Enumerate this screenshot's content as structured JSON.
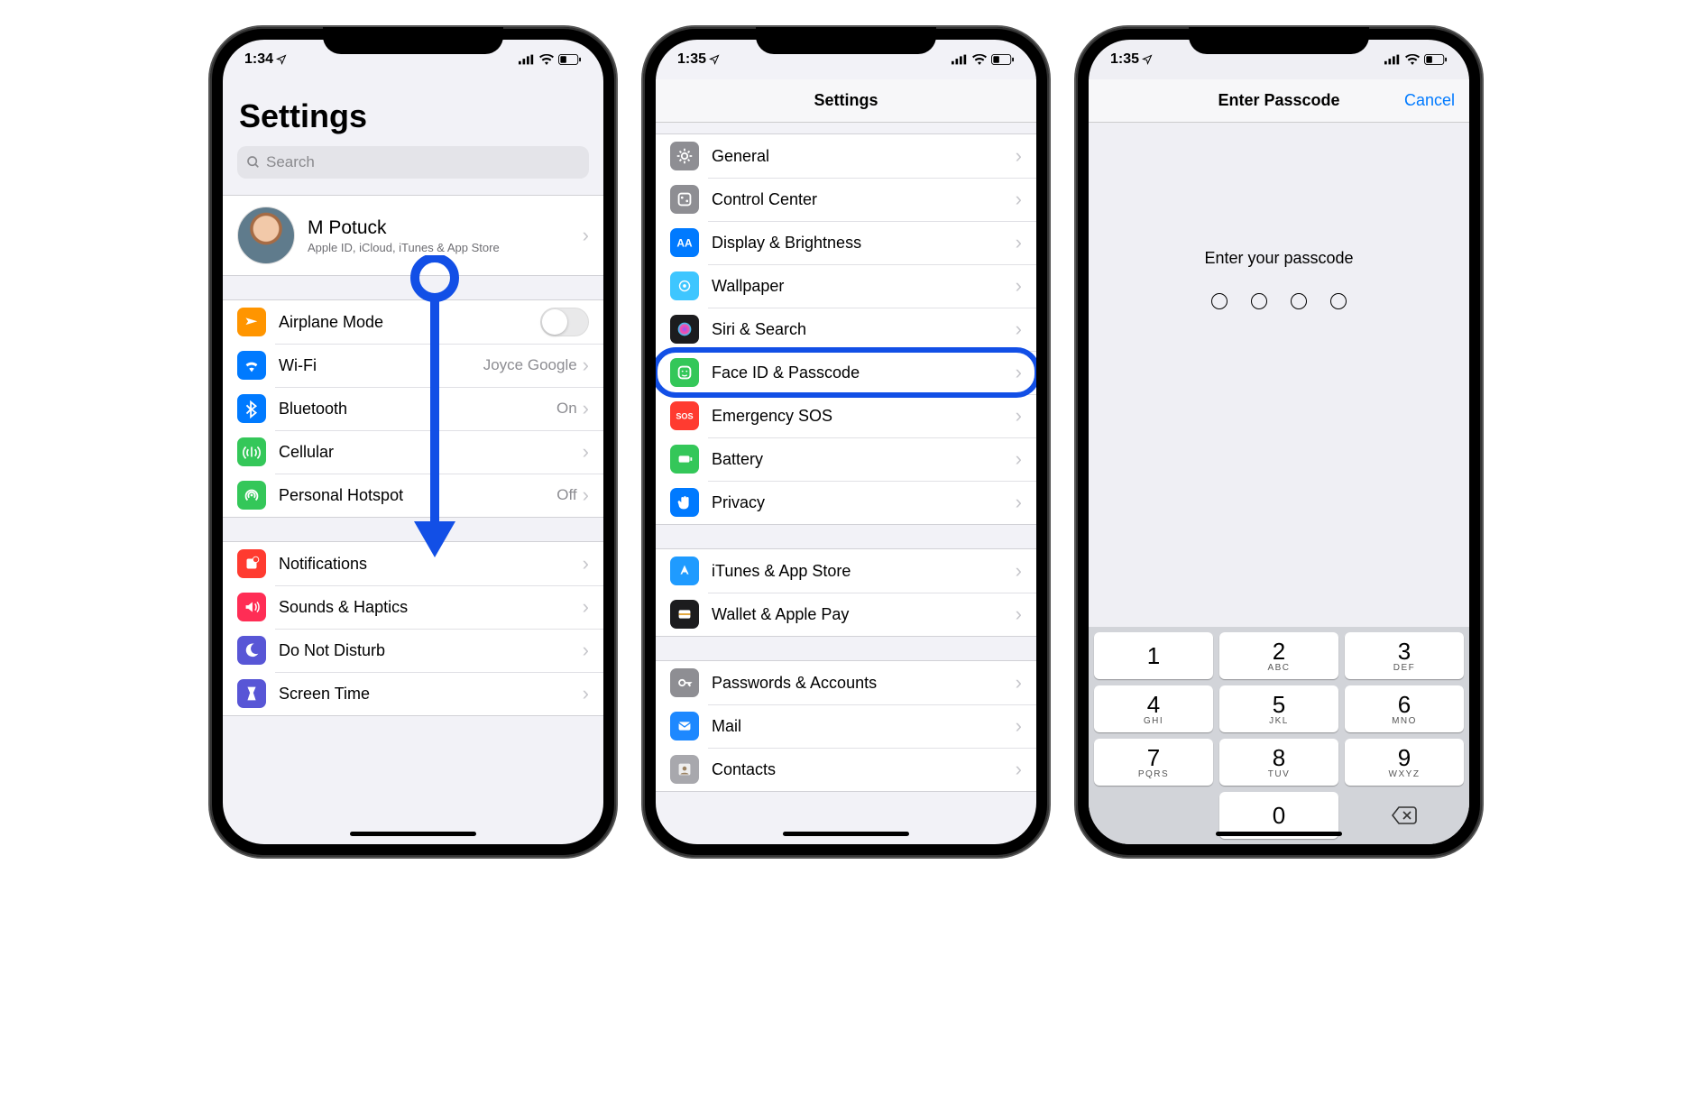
{
  "status": {
    "time1": "1:34",
    "time2": "1:35",
    "time3": "1:35"
  },
  "screen1": {
    "title": "Settings",
    "search_placeholder": "Search",
    "profile": {
      "name": "M Potuck",
      "sub": "Apple ID, iCloud, iTunes & App Store"
    },
    "rows_a": [
      {
        "icon": "airplane",
        "bg": "#ff9500",
        "label": "Airplane Mode",
        "control": "toggle"
      },
      {
        "icon": "wifi",
        "bg": "#007aff",
        "label": "Wi-Fi",
        "value": "Joyce Google"
      },
      {
        "icon": "bluetooth",
        "bg": "#007aff",
        "label": "Bluetooth",
        "value": "On"
      },
      {
        "icon": "cellular",
        "bg": "#34c759",
        "label": "Cellular"
      },
      {
        "icon": "hotspot",
        "bg": "#34c759",
        "label": "Personal Hotspot",
        "value": "Off"
      }
    ],
    "rows_b": [
      {
        "icon": "notif",
        "bg": "#ff3b30",
        "label": "Notifications"
      },
      {
        "icon": "sound",
        "bg": "#ff2d55",
        "label": "Sounds & Haptics"
      },
      {
        "icon": "dnd",
        "bg": "#5856d6",
        "label": "Do Not Disturb"
      },
      {
        "icon": "timer",
        "bg": "#5856d6",
        "label": "Screen Time"
      }
    ]
  },
  "screen2": {
    "title": "Settings",
    "rows_a": [
      {
        "icon": "gear",
        "bg": "#8e8e93",
        "label": "General"
      },
      {
        "icon": "cc",
        "bg": "#8e8e93",
        "label": "Control Center"
      },
      {
        "icon": "aa",
        "bg": "#007aff",
        "label": "Display & Brightness"
      },
      {
        "icon": "wall",
        "bg": "#3ec6ff",
        "label": "Wallpaper"
      },
      {
        "icon": "siri",
        "bg": "#1c1c1e",
        "label": "Siri & Search"
      },
      {
        "icon": "face",
        "bg": "#34c759",
        "label": "Face ID & Passcode",
        "highlight": true
      },
      {
        "icon": "sos",
        "bg": "#ff3b30",
        "label": "Emergency SOS"
      },
      {
        "icon": "batt",
        "bg": "#34c759",
        "label": "Battery"
      },
      {
        "icon": "hand",
        "bg": "#007aff",
        "label": "Privacy"
      }
    ],
    "rows_b": [
      {
        "icon": "store",
        "bg": "#1f9bff",
        "label": "iTunes & App Store"
      },
      {
        "icon": "wallet",
        "bg": "#1c1c1e",
        "label": "Wallet & Apple Pay"
      }
    ],
    "rows_c": [
      {
        "icon": "key",
        "bg": "#8e8e93",
        "label": "Passwords & Accounts"
      },
      {
        "icon": "mail",
        "bg": "#1d88ff",
        "label": "Mail"
      },
      {
        "icon": "cont",
        "bg": "#a8a8ad",
        "label": "Contacts"
      }
    ]
  },
  "screen3": {
    "title": "Enter Passcode",
    "cancel": "Cancel",
    "prompt": "Enter your passcode",
    "keypad": [
      {
        "n": "1",
        "l": ""
      },
      {
        "n": "2",
        "l": "ABC"
      },
      {
        "n": "3",
        "l": "DEF"
      },
      {
        "n": "4",
        "l": "GHI"
      },
      {
        "n": "5",
        "l": "JKL"
      },
      {
        "n": "6",
        "l": "MNO"
      },
      {
        "n": "7",
        "l": "PQRS"
      },
      {
        "n": "8",
        "l": "TUV"
      },
      {
        "n": "9",
        "l": "WXYZ"
      },
      {
        "blank": true
      },
      {
        "n": "0",
        "l": ""
      },
      {
        "backspace": true
      }
    ]
  },
  "icons": {
    "airplane": "✈",
    "wifi": "wifi",
    "bluetooth": "bt",
    "cellular": "ant",
    "hotspot": "link",
    "notif": "□",
    "sound": "🔊",
    "dnd": "☾",
    "timer": "⌛",
    "gear": "⚙",
    "cc": "⊟",
    "aa": "AA",
    "wall": "✲",
    "siri": "●",
    "face": "☺",
    "sos": "SOS",
    "batt": "▮",
    "hand": "✋",
    "store": "A",
    "wallet": "▭",
    "key": "🔑",
    "mail": "✉",
    "cont": "◐"
  }
}
